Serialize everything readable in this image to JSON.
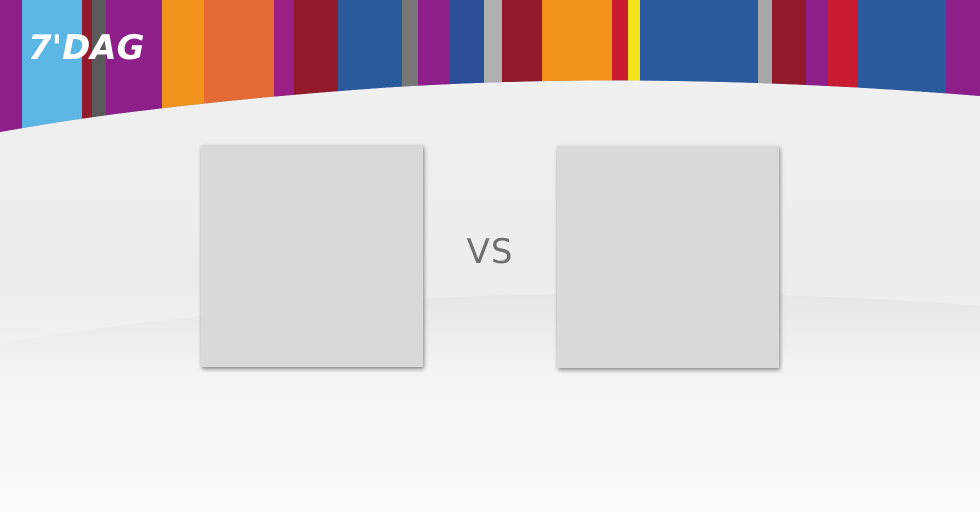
{
  "brand": {
    "logo_text": "7'DAG",
    "logo_color": "#ffffff"
  },
  "banner": {
    "stripe_colors": [
      "#8e1f8a",
      "#5bb6e6",
      "#5a5a5a",
      "#e8891e",
      "#e56a2e",
      "#931a2a",
      "#2b4f96",
      "#7a7a7a",
      "#c91c30",
      "#f0e020",
      "#a8a8a8"
    ]
  },
  "comparison": {
    "left_image_alt": "",
    "right_image_alt": "",
    "separator_text": "VS"
  },
  "colors": {
    "placeholder": "#d9d9d9",
    "separator": "#6e6e6e",
    "background": "#f1f1f1"
  }
}
